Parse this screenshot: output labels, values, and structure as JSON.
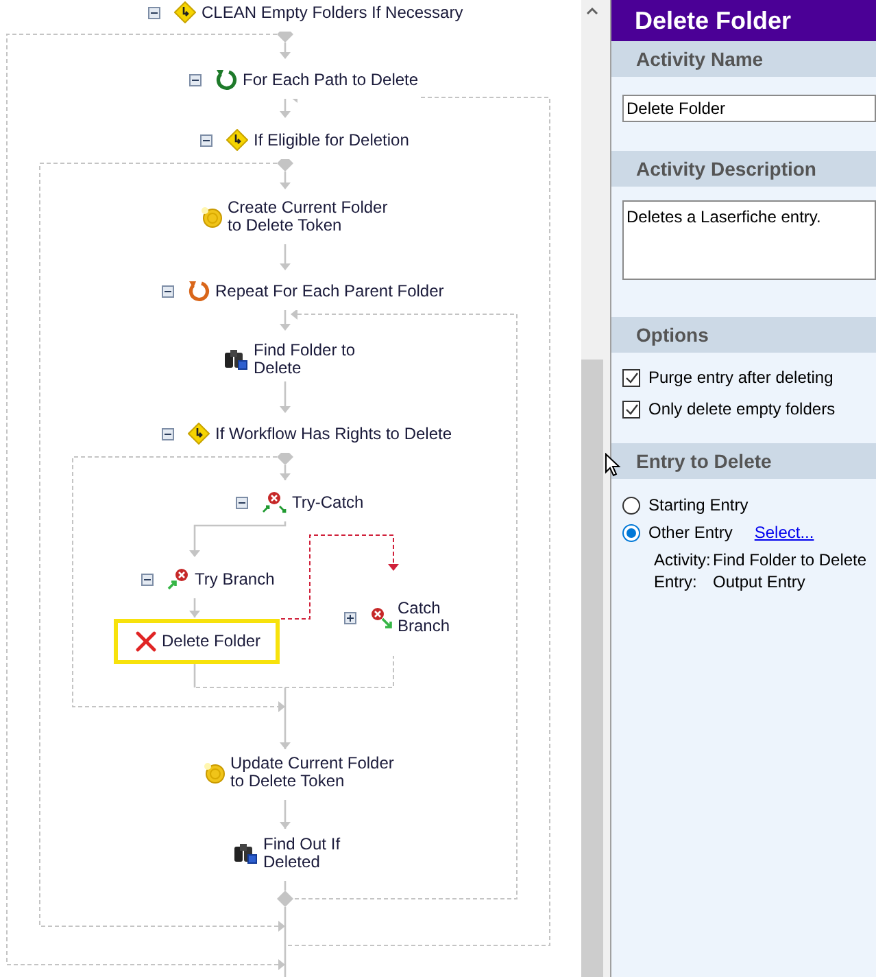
{
  "canvas": {
    "nodes": [
      {
        "label": [
          "CLEAN Empty Folders If Necessary"
        ],
        "kind": "condition",
        "expanded": true,
        "selected": false
      },
      {
        "label": [
          "For Each Path to Delete"
        ],
        "kind": "for-each",
        "expanded": true,
        "selected": false
      },
      {
        "label": [
          "If Eligible for Deletion"
        ],
        "kind": "condition",
        "expanded": true,
        "selected": false
      },
      {
        "label": [
          "Create Current Folder",
          "to Delete Token"
        ],
        "kind": "token",
        "selected": false
      },
      {
        "label": [
          "Repeat For Each Parent Folder"
        ],
        "kind": "repeat",
        "expanded": true,
        "selected": false
      },
      {
        "label": [
          "Find Folder to",
          "Delete"
        ],
        "kind": "search",
        "selected": false
      },
      {
        "label": [
          "If Workflow Has Rights to Delete"
        ],
        "kind": "condition",
        "expanded": true,
        "selected": false
      },
      {
        "label": [
          "Try-Catch"
        ],
        "kind": "try-catch",
        "expanded": true,
        "selected": false
      },
      {
        "label": [
          "Try Branch"
        ],
        "kind": "try",
        "expanded": true,
        "selected": false
      },
      {
        "label": [
          "Delete Folder"
        ],
        "kind": "delete",
        "selected": true
      },
      {
        "label": [
          "Catch",
          "Branch"
        ],
        "kind": "catch",
        "expanded": false,
        "selected": false
      },
      {
        "label": [
          "Update Current Folder",
          "to Delete Token"
        ],
        "kind": "token",
        "selected": false
      },
      {
        "label": [
          "Find Out If",
          "Deleted"
        ],
        "kind": "search",
        "selected": false
      }
    ]
  },
  "panel": {
    "title": "Delete Folder",
    "activity_name": {
      "heading": "Activity Name",
      "value": "Delete Folder"
    },
    "activity_description": {
      "heading": "Activity Description",
      "value": "Deletes a Laserfiche entry."
    },
    "options": {
      "heading": "Options",
      "checkboxes": [
        {
          "label": "Purge entry after deleting",
          "checked": true
        },
        {
          "label": "Only delete empty folders",
          "checked": true
        }
      ]
    },
    "entry_to_delete": {
      "heading": "Entry to Delete",
      "radios": [
        {
          "label": "Starting Entry",
          "selected": false
        },
        {
          "label": "Other Entry",
          "selected": true,
          "link": "Select..."
        }
      ],
      "details": [
        {
          "label": "Activity:",
          "value": "Find Folder to Delete"
        },
        {
          "label": "Entry:",
          "value": "Output Entry"
        }
      ]
    }
  }
}
